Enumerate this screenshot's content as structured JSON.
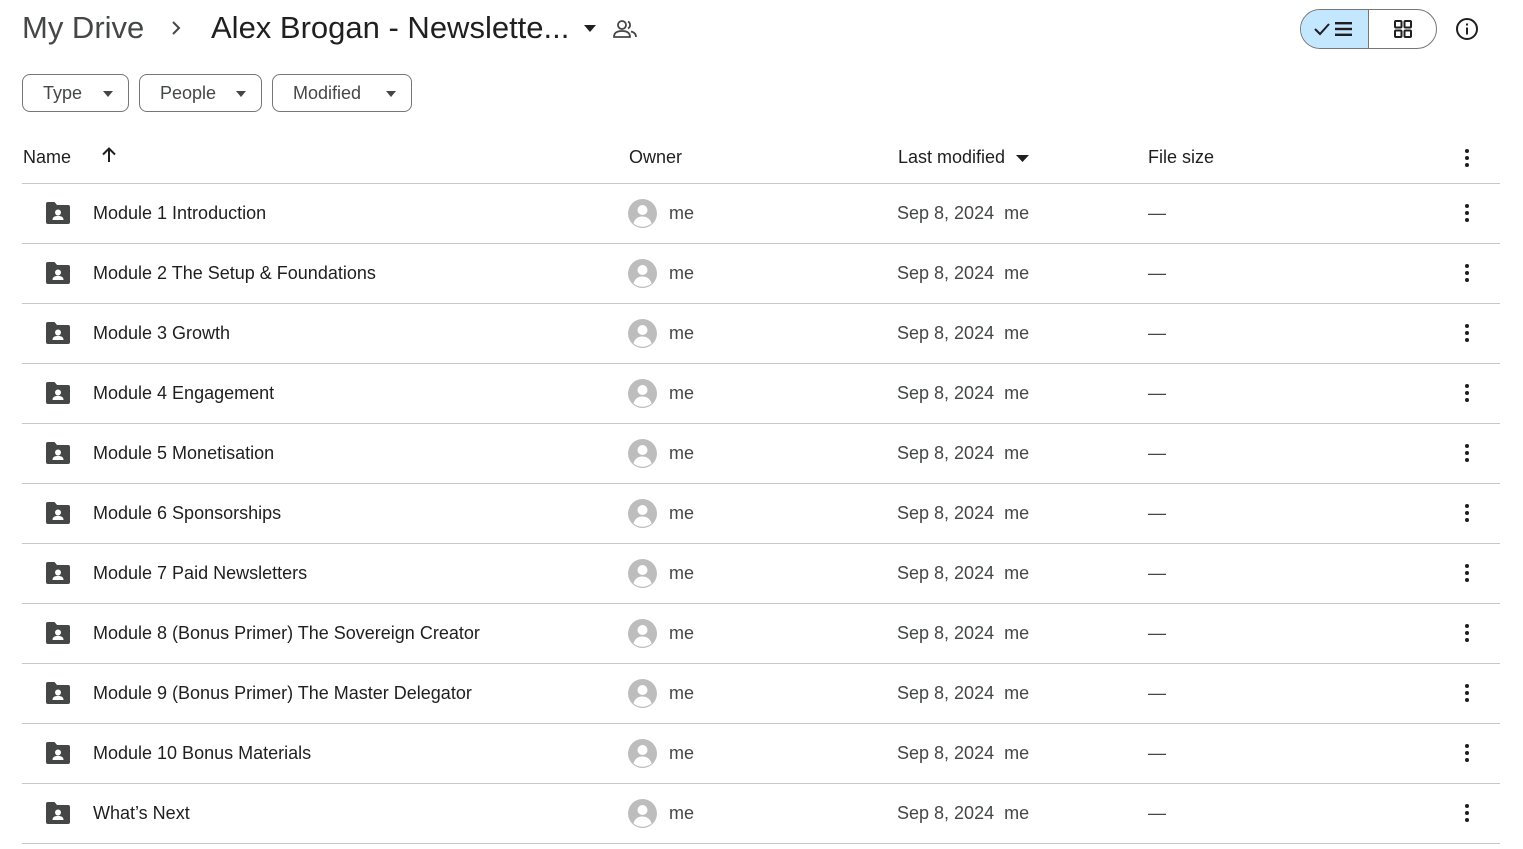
{
  "breadcrumb": {
    "root": "My Drive",
    "current": "Alex Brogan - Newslette..."
  },
  "icons": {
    "breadcrumb_separator": "chevron-right-icon",
    "current_menu": "caret-down-icon",
    "shared": "people-icon",
    "list_view": "check-list-icon",
    "grid_view": "grid-icon",
    "details": "info-icon",
    "folder": "shared-folder-icon",
    "avatar": "person-avatar-icon",
    "more": "more-vert-icon"
  },
  "view_mode": "list",
  "filters": [
    {
      "label": "Type"
    },
    {
      "label": "People"
    },
    {
      "label": "Modified"
    }
  ],
  "columns": {
    "name": "Name",
    "owner": "Owner",
    "last_modified": "Last modified",
    "file_size": "File size"
  },
  "rows": [
    {
      "name": "Module 1 Introduction",
      "owner": "me",
      "modified": "Sep 8, 2024",
      "modified_by": "me",
      "size": "—"
    },
    {
      "name": "Module 2 The Setup & Foundations",
      "owner": "me",
      "modified": "Sep 8, 2024",
      "modified_by": "me",
      "size": "—"
    },
    {
      "name": "Module 3 Growth",
      "owner": "me",
      "modified": "Sep 8, 2024",
      "modified_by": "me",
      "size": "—"
    },
    {
      "name": "Module 4 Engagement",
      "owner": "me",
      "modified": "Sep 8, 2024",
      "modified_by": "me",
      "size": "—"
    },
    {
      "name": "Module 5 Monetisation",
      "owner": "me",
      "modified": "Sep 8, 2024",
      "modified_by": "me",
      "size": "—"
    },
    {
      "name": "Module 6 Sponsorships",
      "owner": "me",
      "modified": "Sep 8, 2024",
      "modified_by": "me",
      "size": "—"
    },
    {
      "name": "Module 7 Paid Newsletters",
      "owner": "me",
      "modified": "Sep 8, 2024",
      "modified_by": "me",
      "size": "—"
    },
    {
      "name": "Module 8 (Bonus Primer) The Sovereign Creator",
      "owner": "me",
      "modified": "Sep 8, 2024",
      "modified_by": "me",
      "size": "—"
    },
    {
      "name": "Module 9 (Bonus Primer) The Master Delegator",
      "owner": "me",
      "modified": "Sep 8, 2024",
      "modified_by": "me",
      "size": "—"
    },
    {
      "name": "Module 10 Bonus Materials",
      "owner": "me",
      "modified": "Sep 8, 2024",
      "modified_by": "me",
      "size": "—"
    },
    {
      "name": "What’s Next",
      "owner": "me",
      "modified": "Sep 8, 2024",
      "modified_by": "me",
      "size": "—"
    }
  ],
  "colors": {
    "accent_toggle": "#c2e7ff",
    "text_primary": "#1f1f1f",
    "text_secondary": "#444746",
    "divider": "#c7c7c7",
    "avatar": "#bdbdbd"
  }
}
